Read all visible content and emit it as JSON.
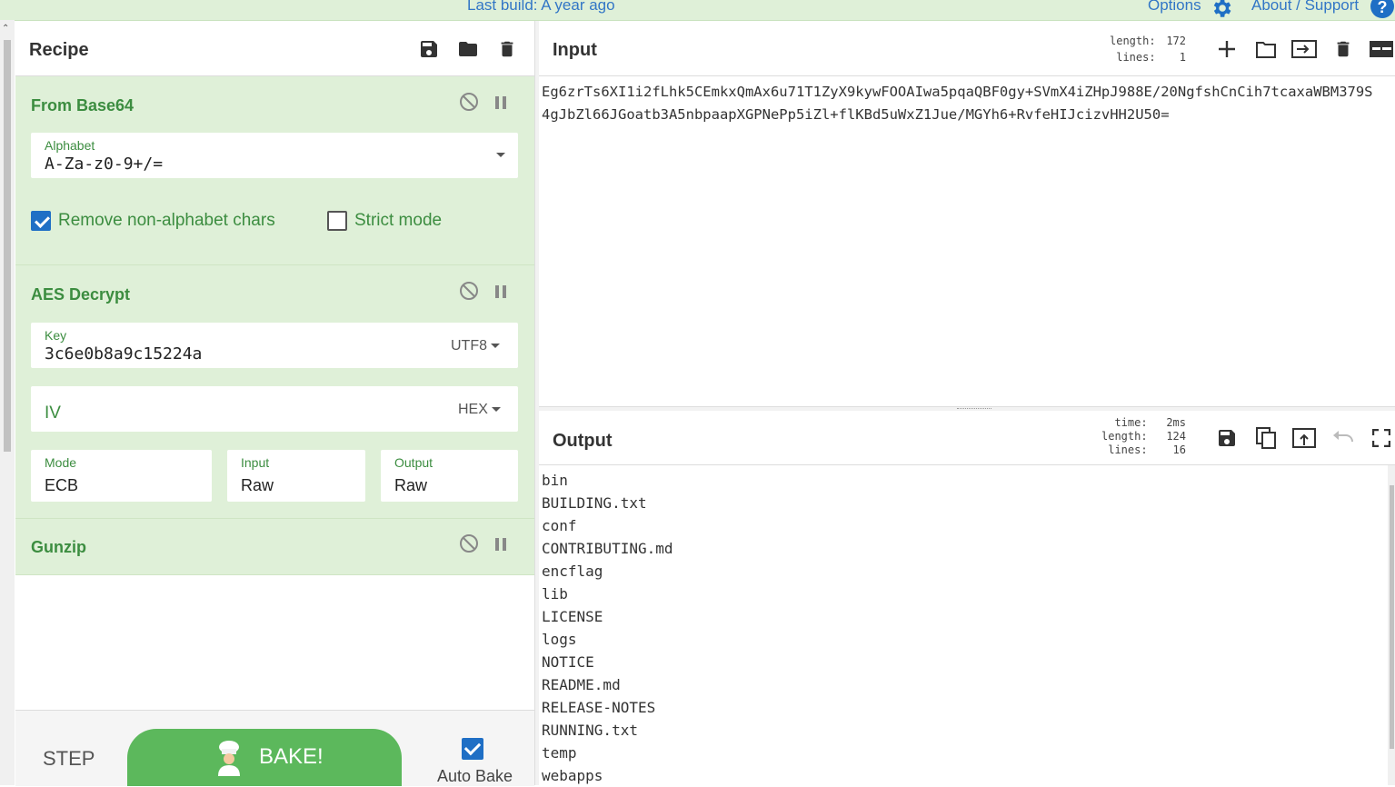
{
  "banner": {
    "last_build": "Last build: A year ago",
    "options": "Options",
    "about": "About / Support",
    "help_glyph": "?"
  },
  "recipe": {
    "title": "Recipe",
    "operations": [
      {
        "name": "From Base64",
        "alphabet_label": "Alphabet",
        "alphabet_value": "A-Za-z0-9+/=",
        "remove_non_alphabet_label": "Remove non-alphabet chars",
        "remove_non_alphabet_checked": true,
        "strict_mode_label": "Strict mode",
        "strict_mode_checked": false
      },
      {
        "name": "AES Decrypt",
        "key_label": "Key",
        "key_value": "3c6e0b8a9c15224a",
        "key_encoding": "UTF8",
        "iv_label": "IV",
        "iv_encoding": "HEX",
        "mode_label": "Mode",
        "mode_value": "ECB",
        "input_label": "Input",
        "input_value": "Raw",
        "output_label": "Output",
        "output_value": "Raw"
      },
      {
        "name": "Gunzip"
      }
    ],
    "step_label": "STEP",
    "bake_label": "BAKE!",
    "auto_bake_label": "Auto Bake",
    "auto_bake_checked": true
  },
  "input": {
    "title": "Input",
    "stats_labels": "length:\nlines:",
    "stats_values": "172\n1",
    "text_line1": "Eg6zrTs6XI1i2fLhk5CEmkxQmAx6u71T1ZyX9kywFOOAIwa5pqaQBF0gy+SVmX4iZHpJ988E/20NgfshCnCih7tcaxaWBM379S",
    "text_line2": "4gJbZl66JGoatb3A5nbpaapXGPNePp5iZl+flKBd5uWxZ1Jue/MGYh6+RvfeHIJcizvHH2U50="
  },
  "output": {
    "title": "Output",
    "stats_labels": "time:\nlength:\nlines:",
    "stats_values": "2ms\n124\n16",
    "lines": [
      "bin",
      "BUILDING.txt",
      "conf",
      "CONTRIBUTING.md",
      "encflag",
      "lib",
      "LICENSE",
      "logs",
      "NOTICE",
      "README.md",
      "RELEASE-NOTES",
      "RUNNING.txt",
      "temp",
      "webapps"
    ]
  },
  "colors": {
    "banner_bg": "#dff0d8",
    "operation_bg": "#dff0d8",
    "operation_title": "#3c8d40",
    "bake_button": "#5cb85c",
    "checkbox_checked": "#1f6fc5",
    "link": "#3276c6"
  }
}
